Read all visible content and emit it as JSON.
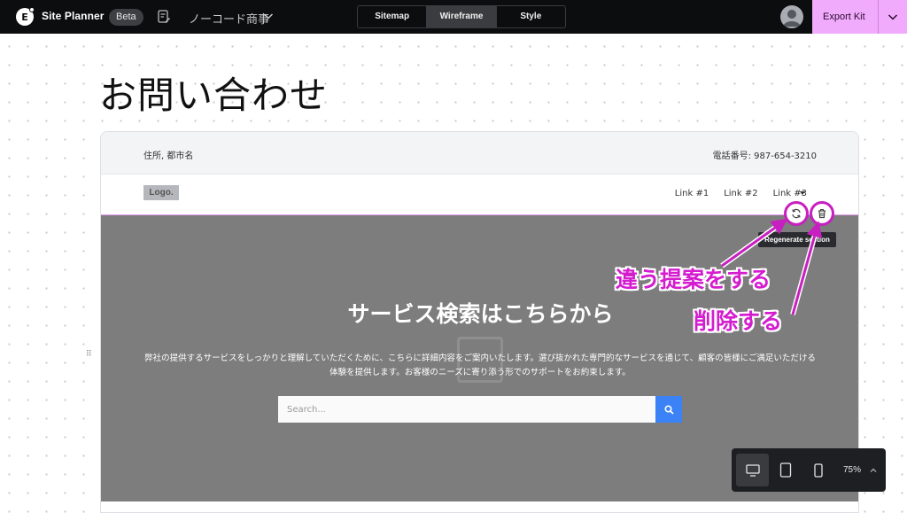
{
  "app": {
    "logo_letter": "E",
    "title": "Site Planner",
    "badge": "Beta",
    "site_name": "ノーコード商事"
  },
  "tabs": [
    {
      "label": "Sitemap",
      "active": false
    },
    {
      "label": "Wireframe",
      "active": true
    },
    {
      "label": "Style",
      "active": false
    }
  ],
  "export": {
    "label": "Export Kit"
  },
  "page": {
    "title": "お問い合わせ"
  },
  "wireframe": {
    "topbar": {
      "address": "住所, 都市名",
      "phone": "電話番号: 987-654-3210"
    },
    "nav": {
      "logo": "Logo.",
      "links": [
        "Link #1",
        "Link #2",
        "Link #3"
      ]
    },
    "hero": {
      "title": "サービス検索はこちらから",
      "description": "弊社の提供するサービスをしっかりと理解していただくために、こちらに詳細内容をご案内いたします。選び抜かれた専門的なサービスを通じて、顧客の皆様にご満足いただける体験を提供します。お客様のニーズに寄り添う形でのサポートをお約束します。",
      "search_placeholder": "Search..."
    },
    "tooltip": "Regenerate section"
  },
  "annotations": {
    "regenerate": "違う提案をする",
    "delete": "削除する"
  },
  "colors": {
    "accent": "#c71fc0",
    "export_bg": "#f0abfc",
    "search_button": "#3b82f6",
    "hero_bg": "#7d7d7d"
  },
  "device_toolbar": {
    "devices": [
      "desktop-icon",
      "tablet-icon",
      "mobile-icon"
    ],
    "active": "desktop-icon",
    "zoom": "75%"
  }
}
